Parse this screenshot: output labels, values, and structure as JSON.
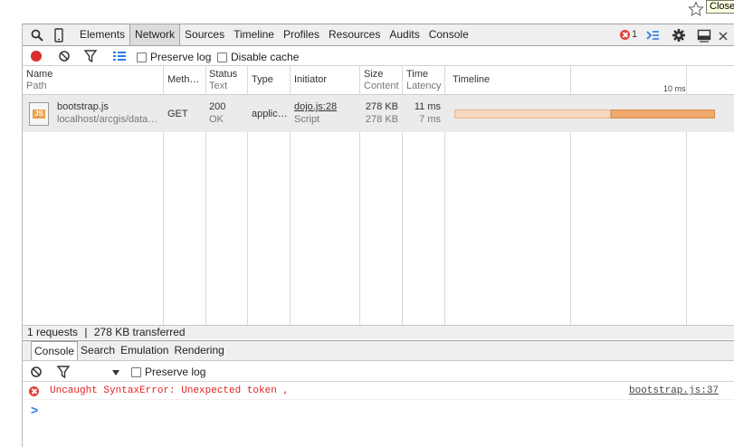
{
  "tooltip": "Close",
  "tabbar": {
    "tabs": [
      "Elements",
      "Network",
      "Sources",
      "Timeline",
      "Profiles",
      "Resources",
      "Audits",
      "Console"
    ],
    "active": "Network",
    "error_count": "1",
    "icons": [
      "search-icon",
      "device-icon",
      "drawer-toggle-icon",
      "gear-icon",
      "dock-icon",
      "close-icon"
    ]
  },
  "network_toolbar": {
    "preserve_log": "Preserve log",
    "disable_cache": "Disable cache"
  },
  "columns": [
    {
      "label": "Name",
      "sub": "Path"
    },
    {
      "label": "Meth…",
      "sub": ""
    },
    {
      "label": "Status",
      "sub": "Text"
    },
    {
      "label": "Type",
      "sub": ""
    },
    {
      "label": "Initiator",
      "sub": ""
    },
    {
      "label": "Size",
      "sub": "Content"
    },
    {
      "label": "Time",
      "sub": "Latency"
    },
    {
      "label": "Timeline",
      "sub": ""
    }
  ],
  "timeline_tick": "10 ms",
  "requests": [
    {
      "name": "bootstrap.js",
      "path": "localhost/arcgis/data…",
      "method": "GET",
      "status": "200",
      "status_text": "OK",
      "type": "applic…",
      "initiator": "dojo.js:28",
      "initiator_type": "Script",
      "size": "278 KB",
      "content": "278 KB",
      "time": "11 ms",
      "latency": "7 ms"
    }
  ],
  "summary": {
    "requests": "1 requests",
    "separator": "|",
    "transferred": "278 KB transferred"
  },
  "drawer": {
    "tabs": [
      "Console",
      "Search",
      "Emulation",
      "Rendering"
    ],
    "active": "Console",
    "preserve_log": "Preserve log"
  },
  "console": {
    "message": "Uncaught SyntaxError: Unexpected token ,",
    "source": "bootstrap.js:37",
    "prompt": ">"
  },
  "colors": {
    "record": "#d92c2c",
    "error": "#e22222",
    "timeline_waiting": "#f6d7bf",
    "timeline_receiving": "#f0aa6e"
  }
}
